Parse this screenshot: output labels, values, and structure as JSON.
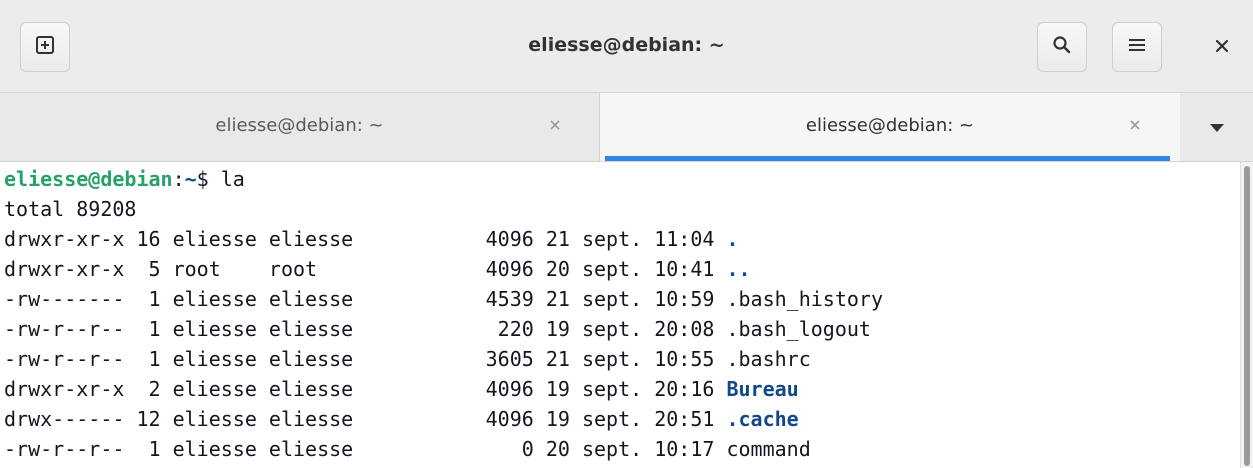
{
  "window": {
    "title": "eliesse@debian: ~"
  },
  "headerbar": {
    "new_tab_icon": "new-tab-icon",
    "search_icon": "search-icon",
    "menu_icon": "hamburger-menu-icon",
    "close_icon": "close-icon"
  },
  "tabs": [
    {
      "label": "eliesse@debian: ~",
      "active": false
    },
    {
      "label": "eliesse@debian: ~",
      "active": true
    }
  ],
  "terminal": {
    "prompt": {
      "user_host": "eliesse@debian",
      "separator": ":",
      "path": "~",
      "symbol": "$",
      "command": " la"
    },
    "total": "total 89208",
    "entries": [
      {
        "meta": "drwxr-xr-x 16 eliesse eliesse           4096 21 sept. 11:04 ",
        "name": ".",
        "type": "dir"
      },
      {
        "meta": "drwxr-xr-x  5 root    root              4096 20 sept. 10:41 ",
        "name": "..",
        "type": "dir"
      },
      {
        "meta": "-rw-------  1 eliesse eliesse           4539 21 sept. 10:59 ",
        "name": ".bash_history",
        "type": "file"
      },
      {
        "meta": "-rw-r--r--  1 eliesse eliesse            220 19 sept. 20:08 ",
        "name": ".bash_logout",
        "type": "file"
      },
      {
        "meta": "-rw-r--r--  1 eliesse eliesse           3605 21 sept. 10:55 ",
        "name": ".bashrc",
        "type": "file"
      },
      {
        "meta": "drwxr-xr-x  2 eliesse eliesse           4096 19 sept. 20:16 ",
        "name": "Bureau",
        "type": "dir"
      },
      {
        "meta": "drwx------ 12 eliesse eliesse           4096 19 sept. 20:51 ",
        "name": ".cache",
        "type": "dir"
      },
      {
        "meta": "-rw-r--r--  1 eliesse eliesse              0 20 sept. 10:17 ",
        "name": "command",
        "type": "file"
      }
    ]
  },
  "colors": {
    "accent": "#3584e4",
    "prompt_user": "#26a269",
    "directory": "#12488b",
    "text": "#171421"
  }
}
